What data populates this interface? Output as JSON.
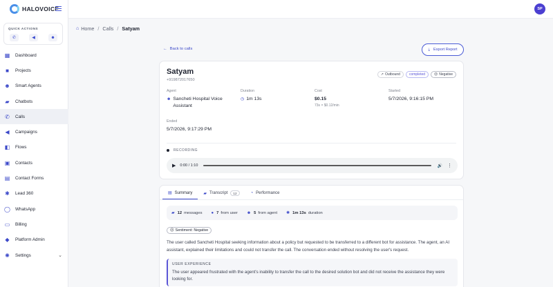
{
  "brand": {
    "name": "HALOVOICE"
  },
  "user": {
    "initials": "SP"
  },
  "quick_actions": {
    "title": "QUICK ACTIONS"
  },
  "nav": [
    {
      "label": "Dashboard",
      "icon": "grid-icon"
    },
    {
      "label": "Projects",
      "icon": "folder-icon"
    },
    {
      "label": "Smart Agents",
      "icon": "robot-icon"
    },
    {
      "label": "Chatbots",
      "icon": "chat-icon"
    },
    {
      "label": "Calls",
      "icon": "phone-icon"
    },
    {
      "label": "Campaigns",
      "icon": "megaphone-icon"
    },
    {
      "label": "Flows",
      "icon": "flow-icon"
    },
    {
      "label": "Contacts",
      "icon": "contacts-icon"
    },
    {
      "label": "Contact Forms",
      "icon": "form-icon"
    },
    {
      "label": "Lead 360",
      "icon": "lead-icon"
    },
    {
      "label": "WhatsApp",
      "icon": "whatsapp-icon"
    },
    {
      "label": "Billing",
      "icon": "billing-icon"
    },
    {
      "label": "Platform Admin",
      "icon": "admin-icon"
    },
    {
      "label": "Settings",
      "icon": "gear-icon"
    }
  ],
  "breadcrumb": {
    "home": "Home",
    "calls": "Calls",
    "current": "Satyam"
  },
  "back_label": "Back to calls",
  "export_label": "Export Report",
  "call": {
    "name": "Satyam",
    "phone": "+919872017650",
    "tags": {
      "direction": "Outbound",
      "status": "completed",
      "sentiment": "Negative"
    },
    "agent_label": "Agent",
    "agent_value": "Sancheti Hospital Voice Assistant",
    "duration_label": "Duration",
    "duration_value": "1m 13s",
    "cost_label": "Cost",
    "cost_value": "$0.15",
    "cost_sub": "73s × $0.12/min",
    "started_label": "Started",
    "started_value": "5/7/2026, 9:16:15 PM",
    "ended_label": "Ended",
    "ended_value": "5/7/2026, 9:17:29 PM",
    "recording_label": "RECORDING",
    "player_time": "0:00 / 1:10"
  },
  "tabs": {
    "summary": "Summary",
    "transcript": "Transcript",
    "transcript_count": "12",
    "performance": "Performance"
  },
  "stats": {
    "messages_count": "12",
    "messages_label": "messages",
    "user_count": "7",
    "user_label": "from user",
    "agent_count": "5",
    "agent_label": "from agent",
    "duration_value": "1m 13s",
    "duration_label": "duration"
  },
  "sentiment_label": "Sentiment: Negative",
  "summary_text": "The user called Sancheti Hospital seeking information about a policy but requested to be transferred to a different bot for assistance. The agent, an AI assistant, explained their limitations and could not transfer the call. The conversation ended without resolving the user's request.",
  "user_experience": {
    "title": "USER EXPERIENCE",
    "text": "The user appeared frustrated with the agent's inability to transfer the call to the desired solution bot and did not receive the assistance they were looking for."
  },
  "colors": {
    "accent": "#3b48c9",
    "avatar": "#4b3fd1",
    "active_nav": "#eef0f5"
  }
}
